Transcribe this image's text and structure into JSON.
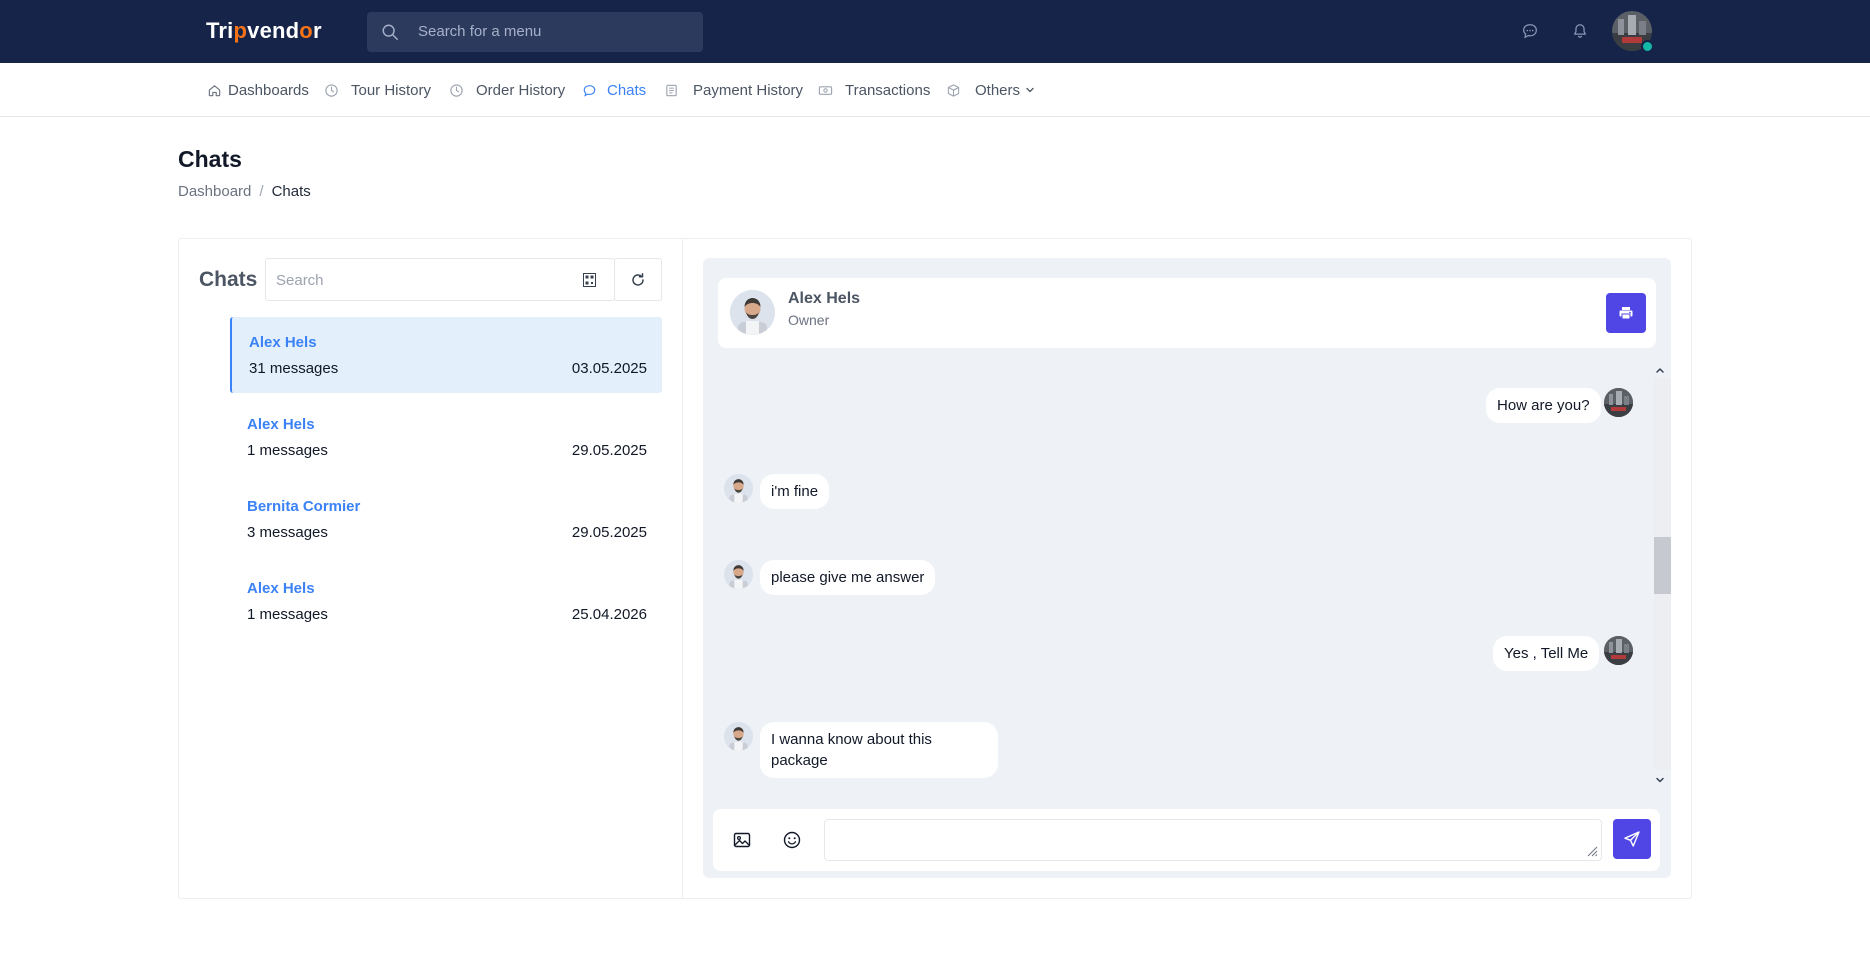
{
  "app": {
    "logo_prefix": "Tri",
    "logo_accent": "p",
    "logo_suffix": "vend",
    "logo_accent2": "o",
    "logo_end": "r",
    "search_placeholder": "Search for a menu"
  },
  "menu": {
    "items": [
      {
        "label": "Dashboards",
        "icon": "home-icon"
      },
      {
        "label": "Tour History",
        "icon": "clock-icon"
      },
      {
        "label": "Order History",
        "icon": "clock-icon"
      },
      {
        "label": "Chats",
        "icon": "chat-icon",
        "active": true
      },
      {
        "label": "Payment History",
        "icon": "receipt-icon"
      },
      {
        "label": "Transactions",
        "icon": "money-icon"
      },
      {
        "label": "Others",
        "icon": "box-icon"
      }
    ]
  },
  "page": {
    "title": "Chats",
    "breadcrumb": {
      "home": "Dashboard",
      "separator": "/",
      "current": "Chats"
    }
  },
  "chat_list": {
    "title": "Chats",
    "search_placeholder": "Search",
    "items": [
      {
        "name": "Alex Hels",
        "count": "31 messages",
        "date": "03.05.2025",
        "active": true
      },
      {
        "name": "Alex Hels",
        "count": "1 messages",
        "date": "29.05.2025"
      },
      {
        "name": "Bernita Cormier",
        "count": "3 messages",
        "date": "29.05.2025"
      },
      {
        "name": "Alex Hels",
        "count": "1 messages",
        "date": "25.04.2026"
      }
    ]
  },
  "conversation": {
    "contact_name": "Alex Hels",
    "contact_role": "Owner",
    "messages": [
      {
        "from": "me",
        "text": "How are you?"
      },
      {
        "from": "them",
        "text": "i'm fine"
      },
      {
        "from": "them",
        "text": "please give me answer"
      },
      {
        "from": "me",
        "text": "Yes , Tell Me"
      },
      {
        "from": "them",
        "text_line1": "I wanna know about this",
        "text_line2": "package"
      }
    ]
  },
  "colors": {
    "topbar": "#16244a",
    "accent": "#3b82f6",
    "button": "#4f46e5",
    "panel": "#eef1f6",
    "online": "#14b8a6"
  }
}
